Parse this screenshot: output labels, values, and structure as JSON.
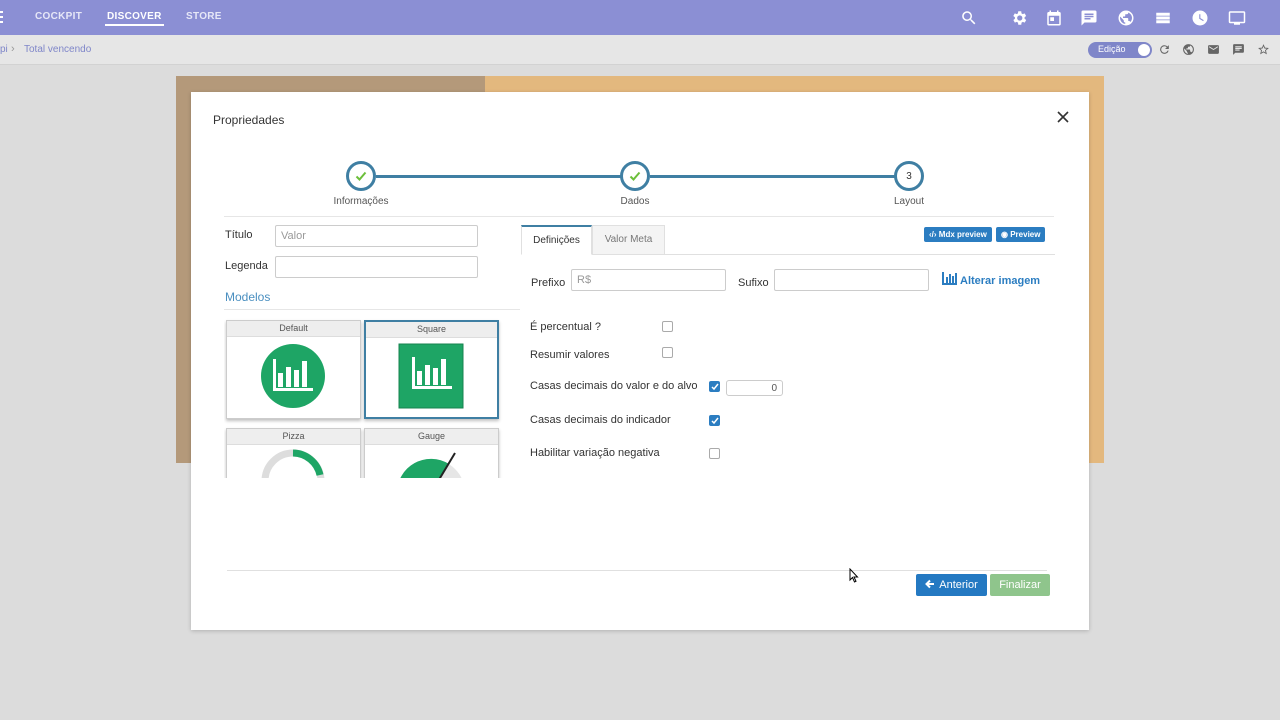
{
  "topbar": {
    "nav": [
      {
        "label": "COCKPIT",
        "active": false
      },
      {
        "label": "DISCOVER",
        "active": true
      },
      {
        "label": "STORE",
        "active": false
      }
    ],
    "icons": [
      "search-icon",
      "gear-icon",
      "calendar-icon",
      "chat-icon",
      "globe-icon",
      "list-icon",
      "clock-icon",
      "monitor-icon"
    ],
    "color": "#8b8fd4"
  },
  "breadcrumb": {
    "prev": "pi",
    "current": "Total vencendo"
  },
  "subbar": {
    "toggle_label": "Edição",
    "icons": [
      "refresh-icon",
      "globe-icon",
      "mail-icon",
      "comment-icon",
      "star-icon"
    ]
  },
  "modal": {
    "title": "Propriedades",
    "steps": [
      {
        "label": "Informações",
        "state": "done"
      },
      {
        "label": "Dados",
        "state": "done"
      },
      {
        "label": "Layout",
        "state": "current",
        "number": "3"
      }
    ],
    "left": {
      "titulo_label": "Título",
      "titulo_placeholder": "Valor",
      "legenda_label": "Legenda",
      "legenda_value": "",
      "modelos_title": "Modelos",
      "models": [
        {
          "name": "Default",
          "selected": false
        },
        {
          "name": "Square",
          "selected": true
        },
        {
          "name": "Pizza",
          "selected": false
        },
        {
          "name": "Gauge",
          "selected": false
        }
      ]
    },
    "tabs": [
      {
        "label": "Definições",
        "active": true
      },
      {
        "label": "Valor Meta",
        "active": false
      }
    ],
    "buttons": {
      "mdx_preview": "Mdx preview",
      "preview": "Preview",
      "alterar_imagem": "Alterar imagem",
      "anterior": "Anterior",
      "finalizar": "Finalizar"
    },
    "definicoes": {
      "prefixo_label": "Prefixo",
      "prefixo_placeholder": "R$",
      "sufixo_label": "Sufixo",
      "sufixo_value": "",
      "options": [
        {
          "label": "É percentual ?",
          "checked": false
        },
        {
          "label": "Resumir valores",
          "checked": false
        },
        {
          "label": "Casas decimais do valor e do alvo",
          "checked": true
        },
        {
          "label": "Casas decimais do indicador",
          "checked": true
        },
        {
          "label": "Habilitar variação negativa",
          "checked": false
        }
      ],
      "decimais_value": "0"
    },
    "colors": {
      "accent": "#3f7fa3",
      "primary_button": "#2479c2",
      "finish_button": "#8fc58c",
      "model_green": "#1ea565"
    }
  }
}
